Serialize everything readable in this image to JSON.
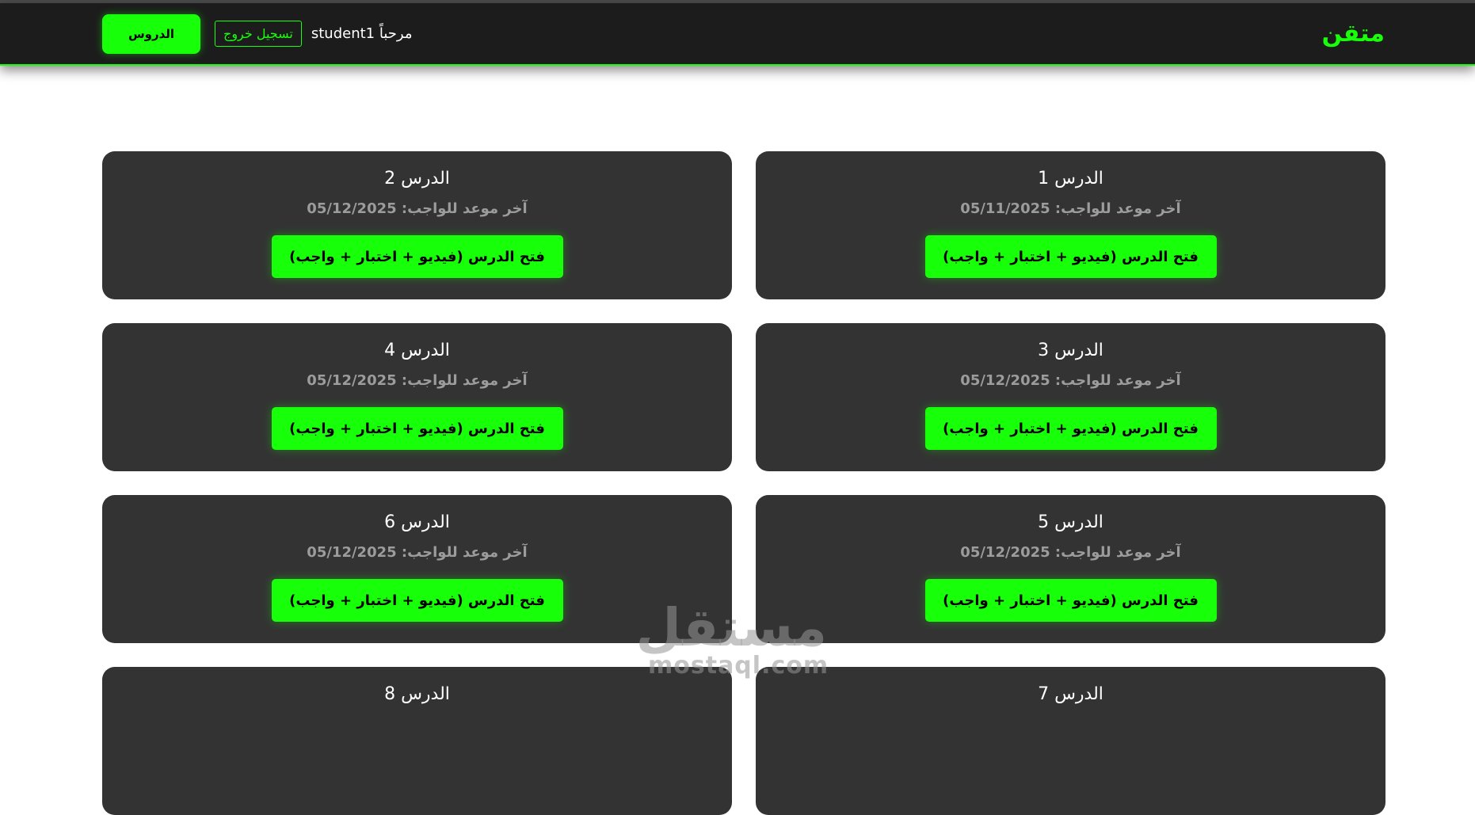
{
  "header": {
    "logo": "متقن",
    "welcome_prefix": "مرحباً",
    "username": "student1",
    "logout_label": "تسجيل خروج",
    "lessons_label": "الدروس"
  },
  "colors": {
    "accent": "#18ff0a",
    "header_bg": "#1c1c1c",
    "card_bg": "#333333"
  },
  "lessons": [
    {
      "title": "الدرس 1",
      "due": "آخر موعد للواجب: 05/11/2025",
      "button": "فتح الدرس (فيديو + اختبار + واجب)"
    },
    {
      "title": "الدرس 2",
      "due": "آخر موعد للواجب: 05/12/2025",
      "button": "فتح الدرس (فيديو + اختبار + واجب)"
    },
    {
      "title": "الدرس 3",
      "due": "آخر موعد للواجب: 05/12/2025",
      "button": "فتح الدرس (فيديو + اختبار + واجب)"
    },
    {
      "title": "الدرس 4",
      "due": "آخر موعد للواجب: 05/12/2025",
      "button": "فتح الدرس (فيديو + اختبار + واجب)"
    },
    {
      "title": "الدرس 5",
      "due": "آخر موعد للواجب: 05/12/2025",
      "button": "فتح الدرس (فيديو + اختبار + واجب)"
    },
    {
      "title": "الدرس 6",
      "due": "آخر موعد للواجب: 05/12/2025",
      "button": "فتح الدرس (فيديو + اختبار + واجب)"
    },
    {
      "title": "الدرس 7",
      "due": "",
      "button": ""
    },
    {
      "title": "الدرس 8",
      "due": "",
      "button": ""
    }
  ],
  "watermark": {
    "arabic": "مستقل",
    "latin": "mostaql.com"
  }
}
